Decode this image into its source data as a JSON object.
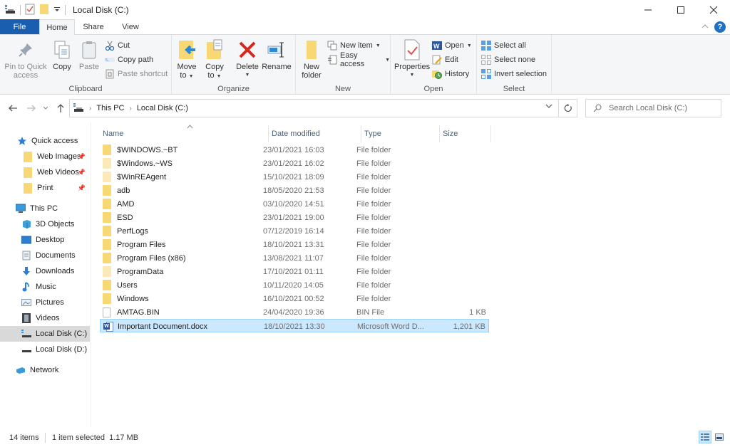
{
  "window": {
    "title": "Local Disk (C:)",
    "controls": {
      "minimize": "—",
      "maximize": "☐",
      "close": "✕"
    }
  },
  "ribbon_tabs": [
    {
      "label": "File"
    },
    {
      "label": "Home"
    },
    {
      "label": "Share"
    },
    {
      "label": "View"
    }
  ],
  "ribbon": {
    "help_label": "?",
    "collapse_glyph": "^",
    "clipboard": {
      "group_label": "Clipboard",
      "pin_line1": "Pin to Quick",
      "pin_line2": "access",
      "copy": "Copy",
      "paste": "Paste",
      "cut": "Cut",
      "copy_path": "Copy path",
      "paste_shortcut": "Paste shortcut"
    },
    "organize": {
      "group_label": "Organize",
      "move_line1": "Move",
      "move_line2": "to",
      "copy_line1": "Copy",
      "copy_line2": "to",
      "delete": "Delete",
      "rename": "Rename"
    },
    "new": {
      "group_label": "New",
      "new_folder_line1": "New",
      "new_folder_line2": "folder",
      "new_item": "New item",
      "easy_access": "Easy access"
    },
    "open": {
      "group_label": "Open",
      "properties": "Properties",
      "open": "Open",
      "edit": "Edit",
      "history": "History"
    },
    "select": {
      "group_label": "Select",
      "select_all": "Select all",
      "select_none": "Select none",
      "invert_selection": "Invert selection"
    }
  },
  "address_bar": {
    "breadcrumbs": [
      "This PC",
      "Local Disk (C:)"
    ],
    "search_placeholder": "Search Local Disk (C:)"
  },
  "nav_pane": {
    "quick_access": "Quick access",
    "quick_items": [
      "Web Images",
      "Web Videos",
      "Print"
    ],
    "this_pc": "This PC",
    "pc_items": [
      "3D Objects",
      "Desktop",
      "Documents",
      "Downloads",
      "Music",
      "Pictures",
      "Videos",
      "Local Disk (C:)",
      "Local Disk (D:)"
    ],
    "network": "Network",
    "selected": "Local Disk (C:)"
  },
  "columns": {
    "name": "Name",
    "date": "Date modified",
    "type": "Type",
    "size": "Size"
  },
  "files": [
    {
      "name": "$WINDOWS.~BT",
      "date": "23/01/2021 16:03",
      "type": "File folder",
      "size": "",
      "icon": "folder"
    },
    {
      "name": "$Windows.~WS",
      "date": "23/01/2021 16:02",
      "type": "File folder",
      "size": "",
      "icon": "folder-hidden"
    },
    {
      "name": "$WinREAgent",
      "date": "15/10/2021 18:09",
      "type": "File folder",
      "size": "",
      "icon": "folder-hidden"
    },
    {
      "name": "adb",
      "date": "18/05/2020 21:53",
      "type": "File folder",
      "size": "",
      "icon": "folder"
    },
    {
      "name": "AMD",
      "date": "03/10/2020 14:51",
      "type": "File folder",
      "size": "",
      "icon": "folder"
    },
    {
      "name": "ESD",
      "date": "23/01/2021 19:00",
      "type": "File folder",
      "size": "",
      "icon": "folder"
    },
    {
      "name": "PerfLogs",
      "date": "07/12/2019 16:14",
      "type": "File folder",
      "size": "",
      "icon": "folder"
    },
    {
      "name": "Program Files",
      "date": "18/10/2021 13:31",
      "type": "File folder",
      "size": "",
      "icon": "folder"
    },
    {
      "name": "Program Files (x86)",
      "date": "13/08/2021 11:07",
      "type": "File folder",
      "size": "",
      "icon": "folder"
    },
    {
      "name": "ProgramData",
      "date": "17/10/2021 01:11",
      "type": "File folder",
      "size": "",
      "icon": "folder-hidden"
    },
    {
      "name": "Users",
      "date": "10/11/2020 14:05",
      "type": "File folder",
      "size": "",
      "icon": "folder"
    },
    {
      "name": "Windows",
      "date": "16/10/2021 00:52",
      "type": "File folder",
      "size": "",
      "icon": "folder"
    },
    {
      "name": "AMTAG.BIN",
      "date": "24/04/2020 19:36",
      "type": "BIN File",
      "size": "1 KB",
      "icon": "file"
    },
    {
      "name": "Important Document.docx",
      "date": "18/10/2021 13:30",
      "type": "Microsoft Word D...",
      "size": "1,201 KB",
      "icon": "word",
      "selected": true
    }
  ],
  "status": {
    "item_count": "14 items",
    "selection": "1 item selected  1.17 MB"
  },
  "colors": {
    "file_tab": "#195eaf",
    "selection_bg": "#cce8ff",
    "selection_border": "#99d1ff",
    "folder": "#f8d775",
    "delete_red": "#d9261c"
  }
}
